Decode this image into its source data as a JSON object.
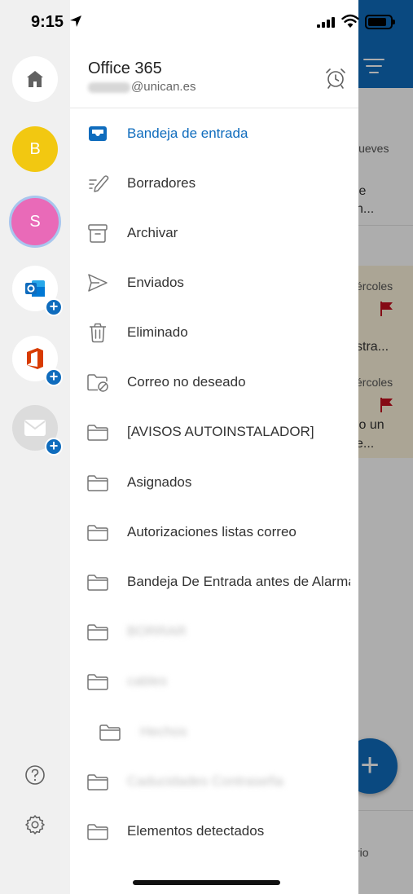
{
  "status_bar": {
    "time": "9:15"
  },
  "background": {
    "rows": [
      {
        "text": "jueves"
      },
      {
        "text": "le"
      },
      {
        "text": "n..."
      },
      {
        "text": "ércoles"
      },
      {
        "text": "stra..."
      },
      {
        "text": "ércoles"
      },
      {
        "text": "lo un"
      },
      {
        "text": "e..."
      },
      {
        "text": "rio"
      }
    ],
    "fab_label": "+"
  },
  "rail": {
    "accounts": [
      {
        "initial": "B",
        "color": "#f2c811"
      },
      {
        "initial": "S",
        "color": "#e96ab8"
      }
    ]
  },
  "drawer": {
    "account_name": "Office 365",
    "account_email_domain": "@unican.es",
    "folders": [
      {
        "label": "Bandeja de entrada"
      },
      {
        "label": "Borradores"
      },
      {
        "label": "Archivar"
      },
      {
        "label": "Enviados"
      },
      {
        "label": "Eliminado"
      },
      {
        "label": "Correo no deseado"
      },
      {
        "label": "[AVISOS AUTOINSTALADOR]"
      },
      {
        "label": "Asignados"
      },
      {
        "label": "Autorizaciones listas correo"
      },
      {
        "label": "Bandeja De Entrada antes de Alarmas"
      },
      {
        "label": "BORRAR"
      },
      {
        "label": "cables"
      },
      {
        "label": "Hechos"
      },
      {
        "label": "Caducidades Contraseña"
      },
      {
        "label": "Elementos detectados"
      }
    ]
  },
  "colors": {
    "accent": "#0f6cbd",
    "rail_bg": "#f0f0f0",
    "flag": "#c50f1f"
  }
}
